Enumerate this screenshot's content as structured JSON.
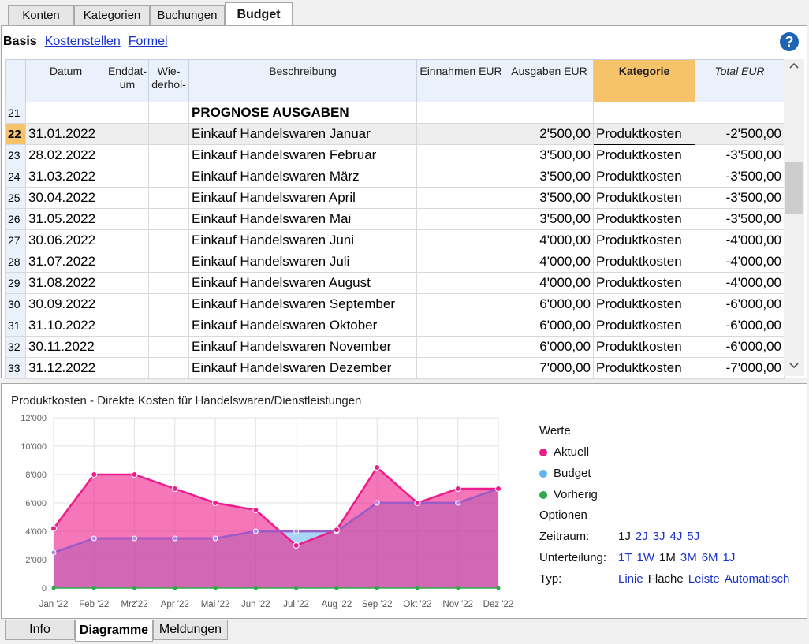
{
  "top_tabs": [
    "Konten",
    "Kategorien",
    "Buchungen",
    "Budget"
  ],
  "subnav": {
    "current": "Basis",
    "links": [
      "Kostenstellen",
      "Formel"
    ]
  },
  "help_label": "?",
  "columns": [
    "Datum",
    "Enddat-um",
    "Wie-derhol-",
    "Beschreibung",
    "Einnahmen EUR",
    "Ausgaben EUR",
    "Kategorie",
    "Total EUR"
  ],
  "rows": [
    {
      "n": "21",
      "date": "",
      "desc": "PROGNOSE AUSGABEN",
      "out": "",
      "cat": "",
      "total": ""
    },
    {
      "n": "22",
      "date": "31.01.2022",
      "desc": "Einkauf Handelswaren Januar",
      "out": "2'500,00",
      "cat": "Produktkosten",
      "total": "-2'500,00"
    },
    {
      "n": "23",
      "date": "28.02.2022",
      "desc": "Einkauf Handelswaren Februar",
      "out": "3'500,00",
      "cat": "Produktkosten",
      "total": "-3'500,00"
    },
    {
      "n": "24",
      "date": "31.03.2022",
      "desc": "Einkauf Handelswaren März",
      "out": "3'500,00",
      "cat": "Produktkosten",
      "total": "-3'500,00"
    },
    {
      "n": "25",
      "date": "30.04.2022",
      "desc": "Einkauf Handelswaren April",
      "out": "3'500,00",
      "cat": "Produktkosten",
      "total": "-3'500,00"
    },
    {
      "n": "26",
      "date": "31.05.2022",
      "desc": "Einkauf Handelswaren Mai",
      "out": "3'500,00",
      "cat": "Produktkosten",
      "total": "-3'500,00"
    },
    {
      "n": "27",
      "date": "30.06.2022",
      "desc": "Einkauf Handelswaren Juni",
      "out": "4'000,00",
      "cat": "Produktkosten",
      "total": "-4'000,00"
    },
    {
      "n": "28",
      "date": "31.07.2022",
      "desc": "Einkauf Handelswaren Juli",
      "out": "4'000,00",
      "cat": "Produktkosten",
      "total": "-4'000,00"
    },
    {
      "n": "29",
      "date": "31.08.2022",
      "desc": "Einkauf Handelswaren August",
      "out": "4'000,00",
      "cat": "Produktkosten",
      "total": "-4'000,00"
    },
    {
      "n": "30",
      "date": "30.09.2022",
      "desc": "Einkauf Handelswaren September",
      "out": "6'000,00",
      "cat": "Produktkosten",
      "total": "-6'000,00"
    },
    {
      "n": "31",
      "date": "31.10.2022",
      "desc": "Einkauf Handelswaren Oktober",
      "out": "6'000,00",
      "cat": "Produktkosten",
      "total": "-6'000,00"
    },
    {
      "n": "32",
      "date": "30.11.2022",
      "desc": "Einkauf Handelswaren November",
      "out": "6'000,00",
      "cat": "Produktkosten",
      "total": "-6'000,00"
    },
    {
      "n": "33",
      "date": "31.12.2022",
      "desc": "Einkauf Handelswaren Dezember",
      "out": "7'000,00",
      "cat": "Produktkosten",
      "total": "-7'000,00"
    }
  ],
  "chart_title": "Produktkosten - Direkte Kosten für Handelswaren/Dienstleistungen",
  "chart_data": {
    "type": "area",
    "title": "Produktkosten - Direkte Kosten für Handelswaren/Dienstleistungen",
    "categories": [
      "Jan '22",
      "Feb '22",
      "Mrz'22",
      "Apr '22",
      "Mai '22",
      "Jun '22",
      "Jul '22",
      "Aug '22",
      "Sep '22",
      "Okt '22",
      "Nov '22",
      "Dez '22"
    ],
    "y_ticks": [
      "0",
      "2'000",
      "4'000",
      "6'000",
      "8'000",
      "10'000",
      "12'000"
    ],
    "ylim": [
      0,
      12000
    ],
    "series": [
      {
        "name": "Aktuell",
        "color": "#ee1c8a",
        "values": [
          4200,
          8000,
          8000,
          7000,
          6000,
          5500,
          3000,
          4100,
          8500,
          6000,
          7000,
          7000
        ]
      },
      {
        "name": "Budget",
        "color": "#5fb4f0",
        "values": [
          2500,
          3500,
          3500,
          3500,
          3500,
          4000,
          4000,
          4000,
          6000,
          6000,
          6000,
          7000
        ]
      },
      {
        "name": "Vorherig",
        "color": "#2eaa4a",
        "values": [
          0,
          0,
          0,
          0,
          0,
          0,
          0,
          0,
          0,
          0,
          0,
          0
        ]
      }
    ],
    "grid": true
  },
  "legend_title": "Werte",
  "legend": [
    {
      "label": "Aktuell",
      "color": "#ee1c8a"
    },
    {
      "label": "Budget",
      "color": "#5fb4f0"
    },
    {
      "label": "Vorherig",
      "color": "#2eaa4a"
    }
  ],
  "options_title": "Optionen",
  "options": {
    "zeitraum": {
      "label": "Zeitraum:",
      "current": "1J",
      "links": [
        "2J",
        "3J",
        "4J",
        "5J"
      ]
    },
    "unterteilung": {
      "label": "Unterteilung:",
      "items": [
        {
          "t": "1T",
          "cur": false
        },
        {
          "t": "1W",
          "cur": false
        },
        {
          "t": "1M",
          "cur": true
        },
        {
          "t": "3M",
          "cur": false
        },
        {
          "t": "6M",
          "cur": false
        },
        {
          "t": "1J",
          "cur": false
        }
      ]
    },
    "typ": {
      "label": "Typ:",
      "items": [
        {
          "t": "Linie",
          "cur": false
        },
        {
          "t": "Fläche",
          "cur": true
        },
        {
          "t": "Leiste",
          "cur": false
        },
        {
          "t": "Automatisch",
          "cur": false
        }
      ]
    }
  },
  "bottom_tabs": [
    "Info",
    "Diagramme",
    "Meldungen"
  ]
}
